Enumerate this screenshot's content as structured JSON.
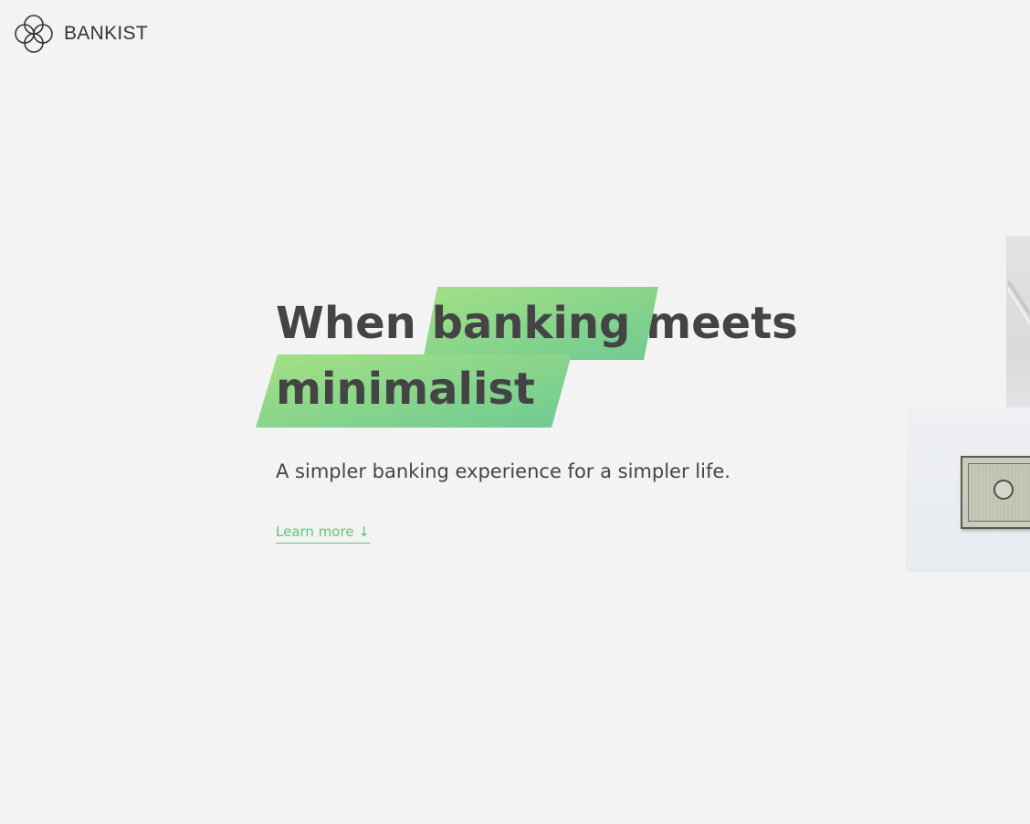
{
  "logo": {
    "icon": "bankist-logo-icon",
    "text": "BANKIST"
  },
  "hero": {
    "headline_word1": "When",
    "headline_highlight1": "banking",
    "headline_word2": "meets",
    "headline_highlight2": "minimalist",
    "subtitle": "A simpler banking experience for a simpler life.",
    "cta_label": "Learn more ↓"
  },
  "colors": {
    "background": "#f3f3f3",
    "text": "#444444",
    "accent": "#5ec576",
    "highlight_start": "#9be15d",
    "highlight_end": "#5ec576"
  },
  "images": {
    "hero_top": "laptop-photo",
    "hero_bottom": "dollar-bill-photo"
  }
}
